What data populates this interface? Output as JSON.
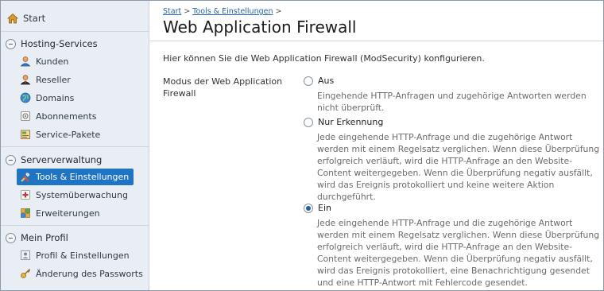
{
  "sidebar": {
    "start": "Start",
    "sections": [
      {
        "title": "Hosting-Services",
        "items": [
          "Kunden",
          "Reseller",
          "Domains",
          "Abonnements",
          "Service-Pakete"
        ]
      },
      {
        "title": "Serververwaltung",
        "items": [
          "Tools & Einstellungen",
          "Systemüberwachung",
          "Erweiterungen"
        ]
      },
      {
        "title": "Mein Profil",
        "items": [
          "Profil & Einstellungen",
          "Änderung des Passworts"
        ]
      }
    ]
  },
  "breadcrumb": {
    "start": "Start",
    "sep": ">",
    "tools": "Tools & Einstellungen"
  },
  "page": {
    "title": "Web Application Firewall",
    "intro": "Hier können Sie die Web Application Firewall (ModSecurity) konfigurieren.",
    "field_label": "Modus der Web Application Firewall"
  },
  "options": [
    {
      "label": "Aus",
      "checked": false,
      "description": "Eingehende HTTP-Anfragen und zugehörige Antworten werden nicht überprüft."
    },
    {
      "label": "Nur Erkennung",
      "checked": false,
      "description": "Jede eingehende HTTP-Anfrage und die zugehörige Antwort werden mit einem Regelsatz verglichen. Wenn diese Überprüfung erfolgreich verläuft, wird die HTTP-Anfrage an den Website-Content weitergegeben. Wenn die Überprüfung negativ ausfällt, wird das Ereignis protokolliert und keine weitere Aktion durchgeführt."
    },
    {
      "label": "Ein",
      "checked": true,
      "description": "Jede eingehende HTTP-Anfrage und die zugehörige Antwort werden mit einem Regelsatz verglichen. Wenn diese Überprüfung erfolgreich verläuft, wird die HTTP-Anfrage an den Website-Content weitergegeben. Wenn die Überprüfung negativ ausfällt, wird das Ereignis protokolliert, eine Benachrichtigung gesendet und eine HTTP-Antwort mit Fehlercode gesendet."
    }
  ],
  "colors": {
    "accent": "#1f74c3",
    "sidebar_bg": "#e8eef3",
    "link": "#2666b0"
  }
}
